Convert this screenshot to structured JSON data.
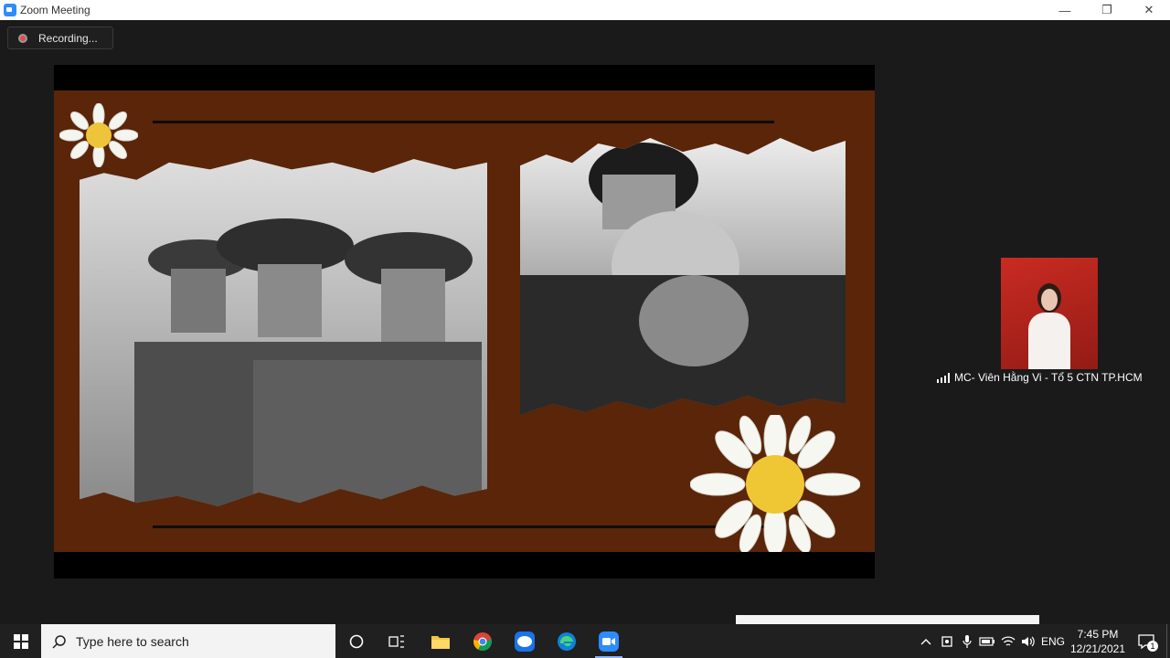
{
  "window": {
    "title": "Zoom Meeting",
    "minimize": "—",
    "restore": "❐",
    "close": "✕"
  },
  "recording": {
    "label": "Recording..."
  },
  "participant": {
    "name": "MC- Viên Hằng Vi - Tổ 5 CTN TP.HCM"
  },
  "taskbar": {
    "search_placeholder": "Type here to search",
    "apps": [
      "task-view",
      "file-explorer",
      "chrome",
      "zalo",
      "edge",
      "zoom"
    ],
    "zalo_label": "Zalo",
    "language": "ENG",
    "time": "7:45 PM",
    "date": "12/21/2021",
    "notification_count": "1"
  },
  "colors": {
    "slide_bg": "#5a2509",
    "zoom_blue": "#2d8cff",
    "taskbar_bg": "#202020",
    "rec_red": "#e84a4a"
  }
}
